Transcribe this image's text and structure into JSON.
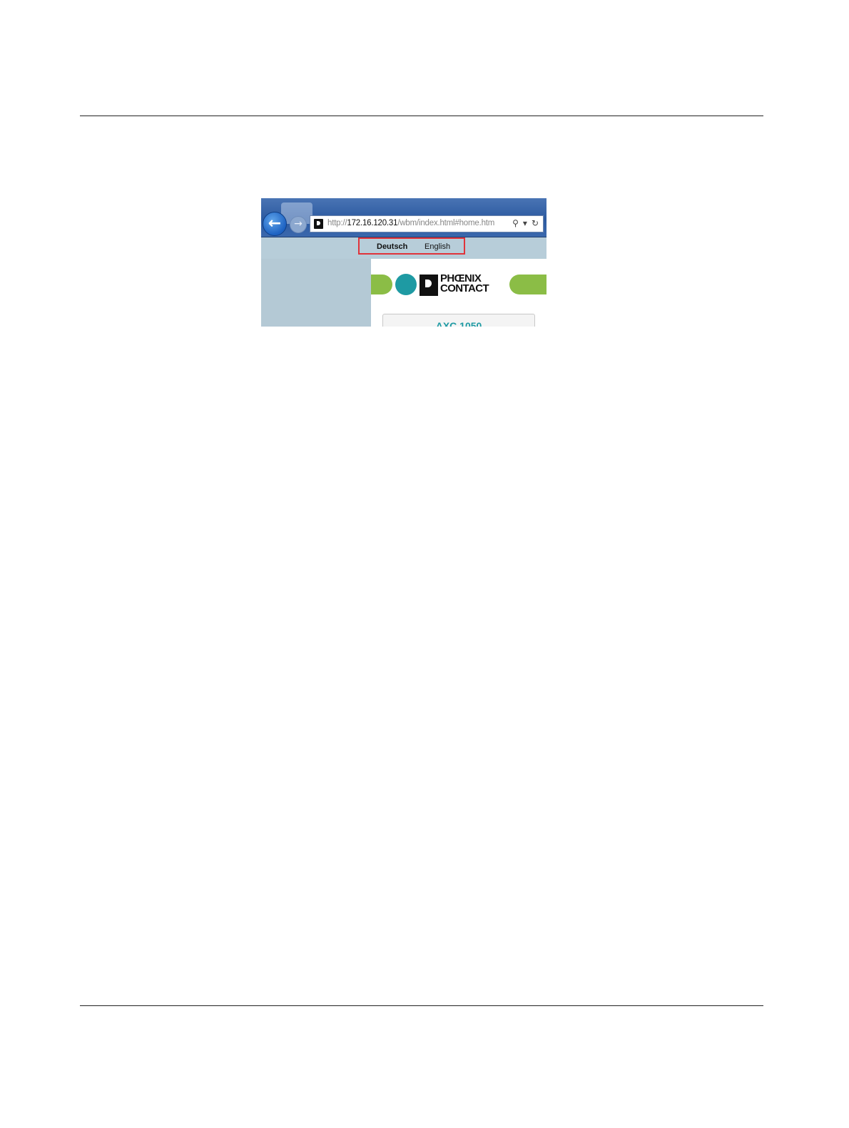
{
  "browser": {
    "url_prefix": "http://",
    "url_host": "172.16.120.31",
    "url_path": "/wbm/index.html#home.htm",
    "back_glyph": "←",
    "forward_glyph": "→",
    "search_glyph": "⚲",
    "dropdown_glyph": "▾",
    "refresh_glyph": "↻"
  },
  "language_selector": {
    "deutsch": "Deutsch",
    "english": "English",
    "highlight_color": "#e0333a"
  },
  "brand": {
    "logo_line1": "PHŒNIX",
    "logo_line2": "CONTACT",
    "green": "#8bbd46",
    "teal": "#1e9aa3"
  },
  "product": {
    "name": "AXC 1050"
  }
}
